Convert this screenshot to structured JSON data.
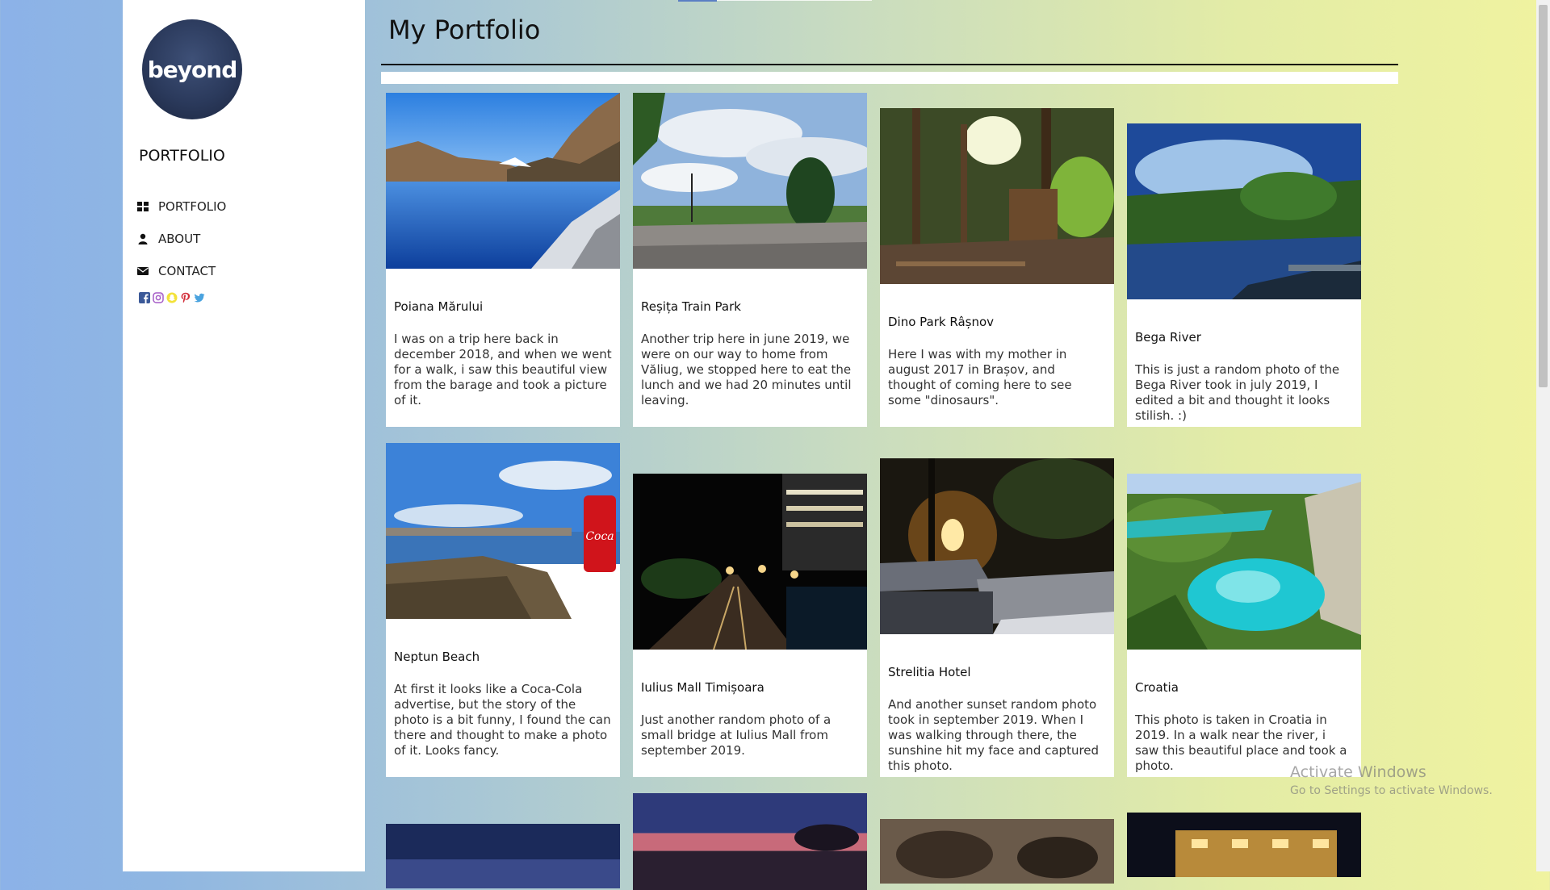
{
  "sidebar": {
    "logo_text": "beyond",
    "title": "PORTFOLIO",
    "nav": [
      {
        "label": "PORTFOLIO",
        "icon": "grid-icon"
      },
      {
        "label": "ABOUT",
        "icon": "user-icon"
      },
      {
        "label": "CONTACT",
        "icon": "envelope-icon"
      }
    ],
    "socials": [
      "facebook-icon",
      "instagram-icon",
      "snapchat-icon",
      "pinterest-icon",
      "twitter-icon"
    ]
  },
  "main": {
    "title": "My Portfolio",
    "cards": [
      {
        "title": "Poiana Mărului",
        "description": "I was on a trip here back in december 2018, and when we went for a walk, i saw this beautiful view from the barage and took a picture of it."
      },
      {
        "title": "Reșița Train Park",
        "description": "Another trip here in june 2019, we were on our way to home from Văliug, we stopped here to eat the lunch and we had 20 minutes until leaving."
      },
      {
        "title": "Dino Park Râșnov",
        "description": "Here I was with my mother in august 2017 in Brașov, and thought of coming here to see some \"dinosaurs\"."
      },
      {
        "title": "Bega River",
        "description": "This is just a random photo of the Bega River took in july 2019, I edited a bit and thought it looks stilish. :)"
      },
      {
        "title": "Neptun Beach",
        "description": "At first it looks like a Coca-Cola advertise, but the story of the photo is a bit funny, I found the can there and thought to make a photo of it. Looks fancy."
      },
      {
        "title": "Iulius Mall Timișoara",
        "description": "Just another random photo of a small bridge at Iulius Mall from september 2019."
      },
      {
        "title": "Strelitia Hotel",
        "description": "And another sunset random photo took in september 2019. When I was walking through there, the sunshine hit my face and captured this photo."
      },
      {
        "title": "Croatia",
        "description": "This photo is taken in Croatia in 2019. In a walk near the river, i saw this beautiful place and took a photo."
      }
    ]
  },
  "watermark": {
    "line1": "Activate Windows",
    "line2": "Go to Settings to activate Windows."
  }
}
